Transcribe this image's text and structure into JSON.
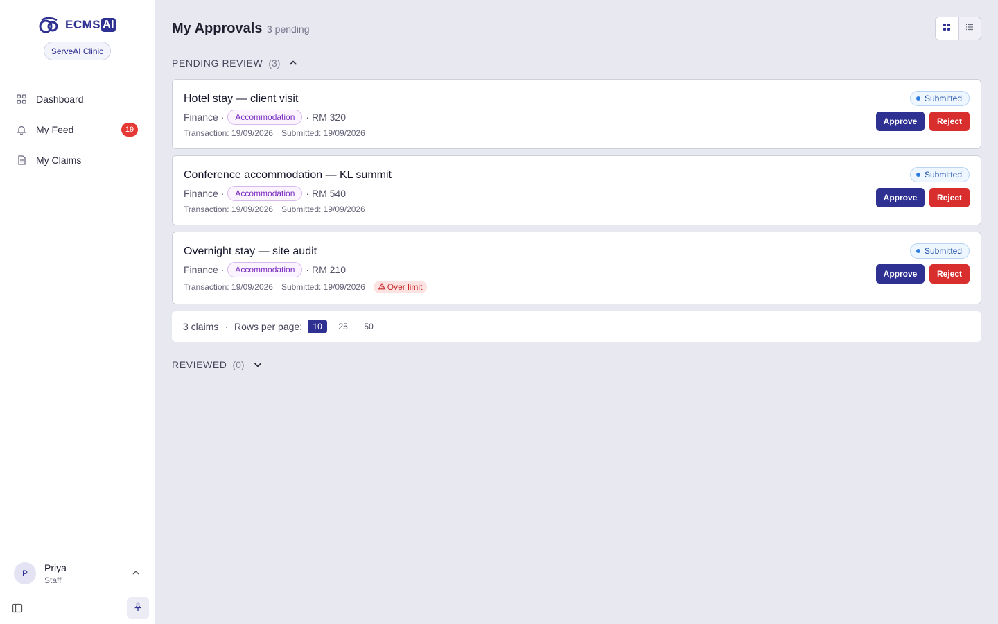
{
  "sidebar": {
    "logo_text": "ECMS",
    "logo_ai": "AI",
    "clinic": "ServeAI Clinic",
    "items": [
      {
        "label": "Dashboard",
        "icon": "grid-icon"
      },
      {
        "label": "My Feed",
        "icon": "bell-icon",
        "badge": "19"
      },
      {
        "label": "My Claims",
        "icon": "document-icon"
      }
    ],
    "user": {
      "initial": "P",
      "name": "Priya",
      "role": "Staff"
    }
  },
  "header": {
    "title": "My Approvals",
    "pending": "3 pending"
  },
  "pending_section": {
    "label": "PENDING REVIEW",
    "count": "(3)"
  },
  "reviewed_section": {
    "label": "REVIEWED",
    "count": "(0)"
  },
  "claims": [
    {
      "title": "Hotel stay — client visit",
      "department": "Finance ·",
      "category": "Accommodation",
      "amount": "· RM 320",
      "transaction": "Transaction: 19/09/2026",
      "submitted": "Submitted: 19/09/2026",
      "status": "Submitted",
      "warning": ""
    },
    {
      "title": "Conference accommodation — KL summit",
      "department": "Finance ·",
      "category": "Accommodation",
      "amount": "· RM 540",
      "transaction": "Transaction: 19/09/2026",
      "submitted": "Submitted: 19/09/2026",
      "status": "Submitted",
      "warning": ""
    },
    {
      "title": "Overnight stay — site audit",
      "department": "Finance ·",
      "category": "Accommodation",
      "amount": "· RM 210",
      "transaction": "Transaction: 19/09/2026",
      "submitted": "Submitted: 19/09/2026",
      "status": "Submitted",
      "warning": "Over limit"
    }
  ],
  "actions": {
    "approve": "Approve",
    "reject": "Reject"
  },
  "pager": {
    "count": "3 claims",
    "rows_label": "Rows per page:",
    "options": [
      "10",
      "25",
      "50"
    ],
    "selected": "10"
  },
  "colors": {
    "brand": "#2e3192",
    "reject": "#d92e2e",
    "status": "#1e4fa8",
    "category": "#7b2cbf"
  }
}
